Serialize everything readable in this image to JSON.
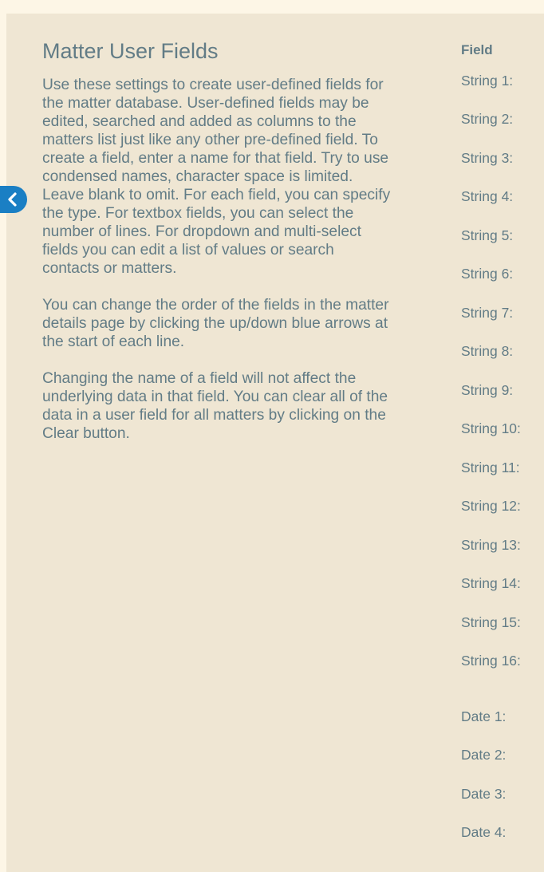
{
  "content": {
    "title": "Matter User Fields",
    "paragraphs": [
      "Use these settings to create user-defined fields for the matter database. User-defined fields may be edited, searched and added as columns to the matters list just like any other pre-defined field. To create a field, enter a name for that field. Try to use condensed names, character space is limited. Leave blank to omit. For each field, you can specify the type. For textbox fields, you can select the number of lines. For dropdown and multi-select fields you can edit a list of values or search contacts or matters.",
      "You can change the order of the fields in the matter details page by clicking the up/down blue arrows at the start of each line.",
      "Changing the name of a field will not affect the underlying data in that field. You can clear all of the data in a user field for all matters by clicking on the Clear button."
    ]
  },
  "fields": {
    "header": "Field",
    "strings": [
      "String 1:",
      "String 2:",
      "String 3:",
      "String 4:",
      "String 5:",
      "String 6:",
      "String 7:",
      "String 8:",
      "String 9:",
      "String 10:",
      "String 11:",
      "String 12:",
      "String 13:",
      "String 14:",
      "String 15:",
      "String 16:"
    ],
    "dates": [
      "Date 1:",
      "Date 2:",
      "Date 3:",
      "Date 4:"
    ]
  },
  "sidebar_toggle": {
    "icon": "chevron-left-icon",
    "color": "#1a7fc4"
  }
}
